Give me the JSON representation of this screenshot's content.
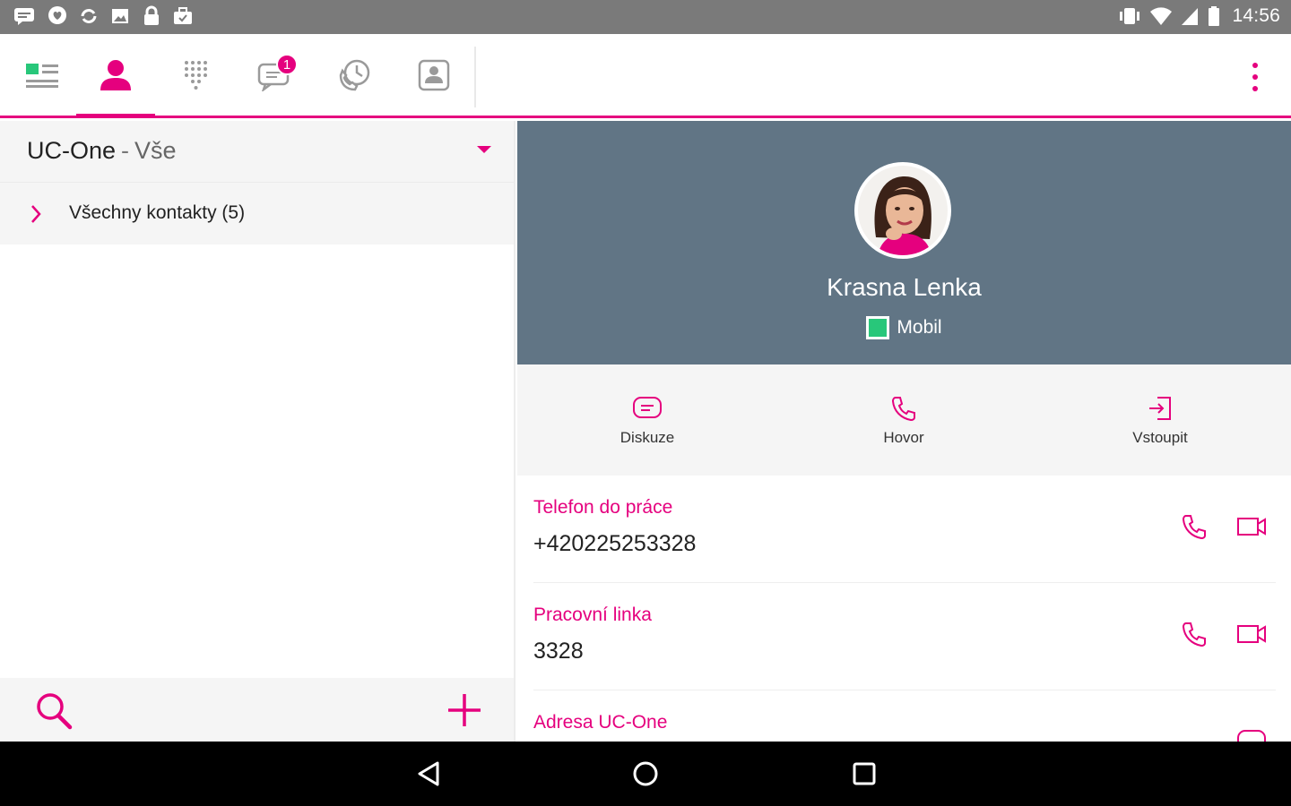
{
  "status_bar": {
    "left_icons": [
      "messages-icon",
      "heart-chat-icon",
      "sync-icon",
      "image-icon",
      "lock-icon",
      "briefcase-icon"
    ],
    "right_icons": [
      "vibrate-icon",
      "wifi-icon",
      "signal-icon",
      "battery-icon"
    ],
    "time": "14:56"
  },
  "tabs": [
    {
      "name": "presence-tab",
      "icon": "presence-list-icon"
    },
    {
      "name": "contacts-tab",
      "icon": "person-icon",
      "active": true
    },
    {
      "name": "dialpad-tab",
      "icon": "dialpad-icon"
    },
    {
      "name": "chat-tab",
      "icon": "chat-icon",
      "badge": "1"
    },
    {
      "name": "call-history-tab",
      "icon": "call-history-icon"
    },
    {
      "name": "my-room-tab",
      "icon": "contact-card-icon"
    }
  ],
  "left_panel": {
    "directory": "UC-One",
    "separator": "-",
    "filter": "Vše",
    "group_label": "Všechny kontakty (5)"
  },
  "contact": {
    "name": "Krasna Lenka",
    "presence": "Mobil",
    "presence_color": "#28c77a"
  },
  "actions": [
    {
      "label": "Diskuze",
      "icon": "chat-icon"
    },
    {
      "label": "Hovor",
      "icon": "phone-icon"
    },
    {
      "label": "Vstoupit",
      "icon": "enter-icon"
    }
  ],
  "details": [
    {
      "label": "Telefon do práce",
      "value": "+420225253328"
    },
    {
      "label": "Pracovní linka",
      "value": "3328"
    },
    {
      "label": "Adresa UC-One",
      "value": ""
    }
  ],
  "colors": {
    "accent": "#e5007e",
    "hero": "#617585",
    "status_bar": "#7a7a7a"
  }
}
